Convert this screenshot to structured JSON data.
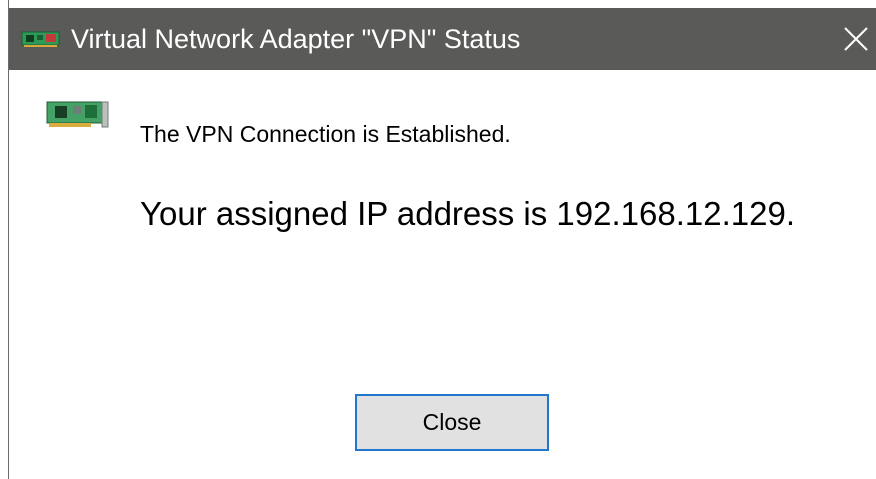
{
  "window": {
    "title": "Virtual Network Adapter \"VPN\" Status",
    "titlebar_color": "#5a5a58",
    "title_icon": "network-adapter-icon",
    "close_icon": "close-icon"
  },
  "content": {
    "adapter_icon": "network-adapter-icon",
    "message": "The VPN Connection is Established.",
    "ip_message": "Your assigned IP address is 192.168.12.129."
  },
  "buttons": {
    "close_label": "Close",
    "accent_color": "#1f77d0"
  }
}
